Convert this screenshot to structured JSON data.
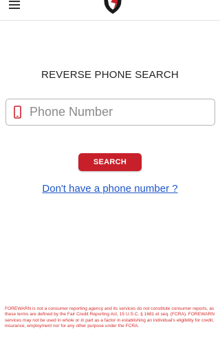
{
  "header": {
    "menu_icon": "hamburger-menu-icon",
    "logo_icon": "shield-logo-icon"
  },
  "main": {
    "title": "REVERSE PHONE SEARCH",
    "phone_icon": "mobile-phone-icon",
    "phone_input": {
      "placeholder": "Phone Number",
      "value": ""
    },
    "search_button_label": "SEARCH",
    "no_phone_link": "Don't have a phone number ?"
  },
  "footer": {
    "disclaimer": "FOREWARN is not a consumer reporting agency and its services do not constitute consumer reports, as these terms are defined by the Fair Credit Reporting Act, 15 U.S.C. § 1681 et seq. (FCRA). FOREWARN services may not be used in whole or in part as a factor in establishing an individual's eligibility for credit, insurance, employment nor for any other purpose under the FCRA."
  },
  "colors": {
    "accent": "#c8202a",
    "link": "#1e56c8",
    "disclaimer": "#d42a2a"
  }
}
